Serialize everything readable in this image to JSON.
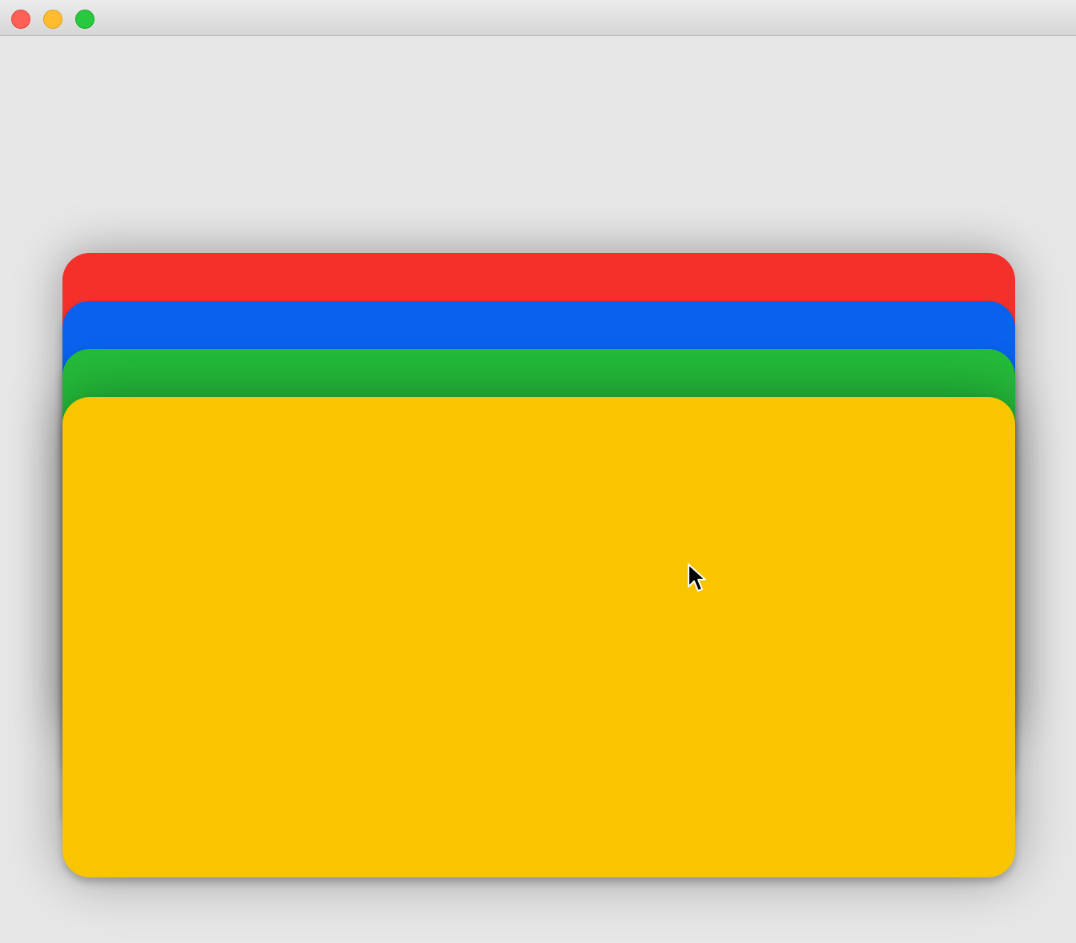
{
  "window": {
    "traffic_lights": [
      {
        "name": "close",
        "color": "#fe5f57",
        "border": "#e0443e"
      },
      {
        "name": "minimize",
        "color": "#febc2e",
        "border": "#dea123"
      },
      {
        "name": "zoom",
        "color": "#28c840",
        "border": "#1aab29"
      }
    ]
  },
  "cards": [
    {
      "name": "red",
      "color": "#f5302a"
    },
    {
      "name": "blue",
      "color": "#0a61ee"
    },
    {
      "name": "green",
      "color": "#24bc3a"
    },
    {
      "name": "yellow",
      "color": "#f9c500"
    }
  ],
  "cursor": {
    "icon": "arrow-cursor-icon"
  }
}
